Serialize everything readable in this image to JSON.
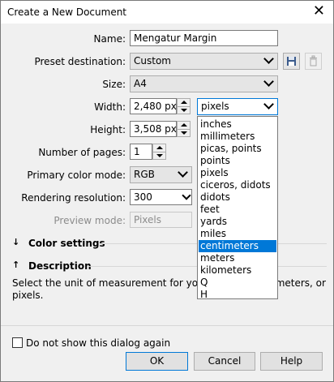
{
  "window": {
    "title": "Create a New Document",
    "close_label": "✕"
  },
  "form": {
    "name": {
      "label": "Name:",
      "value": "Mengatur Margin"
    },
    "preset": {
      "label": "Preset destination:",
      "value": "Custom"
    },
    "size": {
      "label": "Size:",
      "value": "A4"
    },
    "width": {
      "label": "Width:",
      "value": "2,480 px",
      "unit": "pixels"
    },
    "height": {
      "label": "Height:",
      "value": "3,508 px"
    },
    "pages": {
      "label": "Number of pages:",
      "value": "1"
    },
    "color_mode": {
      "label": "Primary color mode:",
      "value": "RGB"
    },
    "resolution": {
      "label": "Rendering resolution:",
      "value": "300"
    },
    "preview": {
      "label": "Preview mode:",
      "value": "Pixels"
    }
  },
  "unit_dropdown": {
    "options": [
      "inches",
      "millimeters",
      "picas, points",
      "points",
      "pixels",
      "ciceros, didots",
      "didots",
      "feet",
      "yards",
      "miles",
      "centimeters",
      "meters",
      "kilometers",
      "Q",
      "H"
    ],
    "highlighted": "centimeters"
  },
  "sections": {
    "color_settings": "Color settings",
    "description": "Description"
  },
  "description_text": "Select the unit of measurement for your do                           ches, millimeters, or pixels.",
  "footer": {
    "checkbox_label": "Do not show this dialog again",
    "ok": "OK",
    "cancel": "Cancel",
    "help": "Help"
  },
  "icons": {
    "save": "save-disk-icon",
    "delete": "trash-icon"
  },
  "colors": {
    "accent": "#0078d7",
    "dialog_bg": "#f0f0f0"
  }
}
